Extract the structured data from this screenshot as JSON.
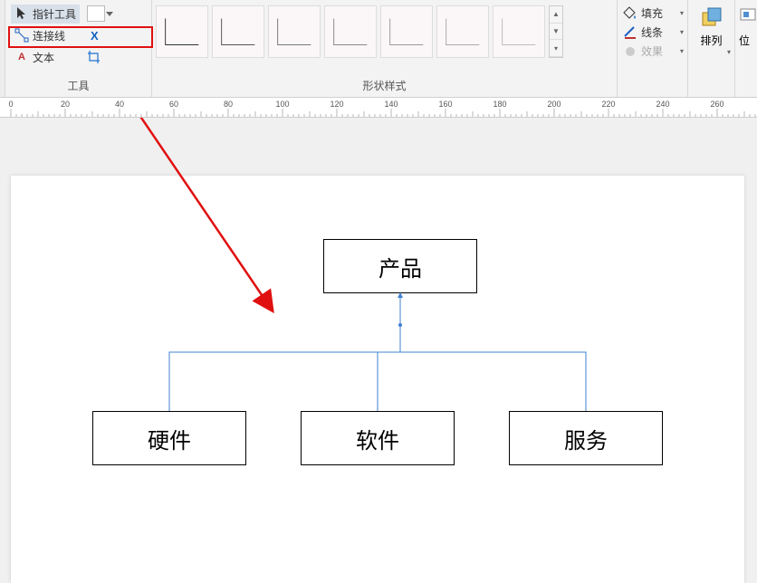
{
  "tools": {
    "pointer": "指针工具",
    "connector": "连接线",
    "text": "文本",
    "group_label": "工具"
  },
  "styles": {
    "group_label": "形状样式"
  },
  "format": {
    "fill": "填充",
    "line": "线条",
    "effect": "效果"
  },
  "arrange": {
    "label": "排列"
  },
  "position": {
    "label": "位"
  },
  "ruler_ticks": [
    0,
    20,
    40,
    60,
    80,
    100,
    120,
    140,
    160,
    180,
    200,
    220,
    240,
    260
  ],
  "diagram": {
    "root": "产品",
    "children": [
      "硬件",
      "软件",
      "服务"
    ]
  }
}
